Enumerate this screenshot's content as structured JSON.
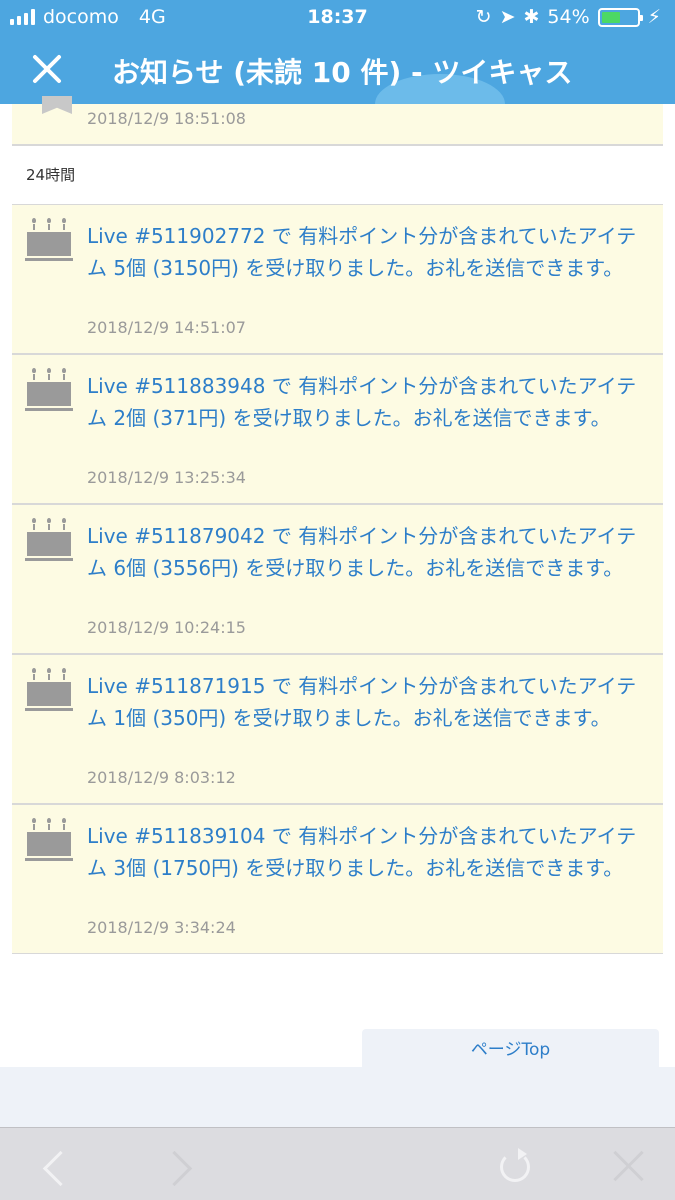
{
  "status_bar": {
    "carrier": "docomo",
    "network": "4G",
    "time": "18:37",
    "battery_percent": "54%",
    "battery_level": 0.54
  },
  "header": {
    "title": "お知らせ (未読 10 件) - ツイキャス"
  },
  "top_card": {
    "timestamp": "2018/12/9 18:51:08"
  },
  "section_label": "24時間",
  "notifications": [
    {
      "message": "Live #511902772 で 有料ポイント分が含まれていたアイテム 5個 (3150円) を受け取りました。お礼を送信できます。",
      "timestamp": "2018/12/9 14:51:07"
    },
    {
      "message": "Live #511883948 で 有料ポイント分が含まれていたアイテム 2個 (371円) を受け取りました。お礼を送信できます。",
      "timestamp": "2018/12/9 13:25:34"
    },
    {
      "message": "Live #511879042 で 有料ポイント分が含まれていたアイテム 6個 (3556円) を受け取りました。お礼を送信できます。",
      "timestamp": "2018/12/9 10:24:15"
    },
    {
      "message": "Live #511871915 で 有料ポイント分が含まれていたアイテム 1個 (350円) を受け取りました。お礼を送信できます。",
      "timestamp": "2018/12/9 8:03:12"
    },
    {
      "message": "Live #511839104 で 有料ポイント分が含まれていたアイテム 3個 (1750円) を受け取りました。お礼を送信できます。",
      "timestamp": "2018/12/9 3:34:24"
    }
  ],
  "page_top_label": "ページTop",
  "colors": {
    "accent": "#4da6e0",
    "link": "#2d7ec9",
    "card_bg": "#fdfbe3"
  }
}
